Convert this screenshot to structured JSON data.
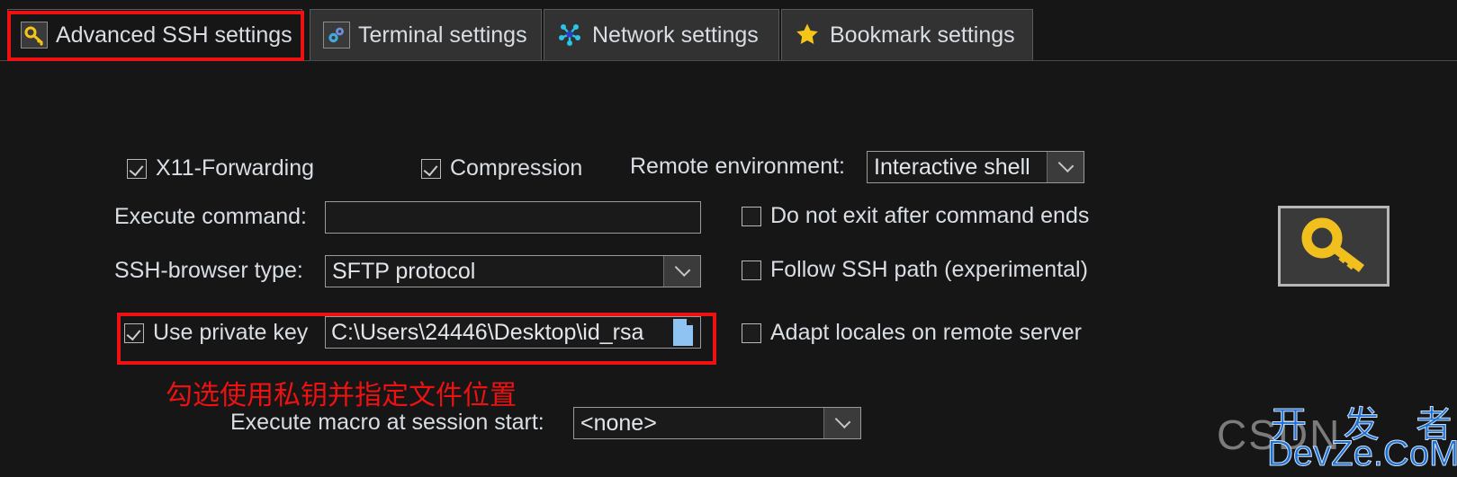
{
  "window": {
    "background_color": "#161616",
    "accent_red": "#ee1111"
  },
  "tabs": [
    {
      "label": "Advanced SSH settings",
      "icon": "key-icon",
      "active": true
    },
    {
      "label": "Terminal settings",
      "icon": "gears-icon",
      "active": false
    },
    {
      "label": "Network settings",
      "icon": "network-nodes-icon",
      "active": false
    },
    {
      "label": "Bookmark settings",
      "icon": "star-icon",
      "active": false
    }
  ],
  "form": {
    "x11_forwarding": {
      "label": "X11-Forwarding",
      "checked": true
    },
    "compression": {
      "label": "Compression",
      "checked": true
    },
    "remote_environment": {
      "label": "Remote environment:",
      "value": "Interactive shell"
    },
    "execute_command": {
      "label": "Execute command:",
      "value": "",
      "placeholder": ""
    },
    "ssh_browser_type": {
      "label": "SSH-browser type:",
      "value": "SFTP protocol"
    },
    "use_private_key": {
      "label": "Use private key",
      "checked": true,
      "path": "C:\\Users\\24446\\Desktop\\id_rsa",
      "browse_icon": "file-document-icon"
    },
    "do_not_exit": {
      "label": "Do not exit after command ends",
      "checked": false
    },
    "follow_ssh_path": {
      "label": "Follow SSH path (experimental)",
      "checked": false
    },
    "adapt_locales": {
      "label": "Adapt locales on remote server",
      "checked": false
    },
    "execute_macro": {
      "label": "Execute macro at session start:",
      "value": "<none>"
    }
  },
  "annotations": {
    "note_text": "勾选使用私钥并指定文件位置",
    "note_color": "#ee1111"
  },
  "key_preview": {
    "icon": "key-icon"
  },
  "watermarks": {
    "csdn": "CSDN",
    "dev_cn": "开 发 者",
    "dev_en": "DevZe.CoM"
  }
}
